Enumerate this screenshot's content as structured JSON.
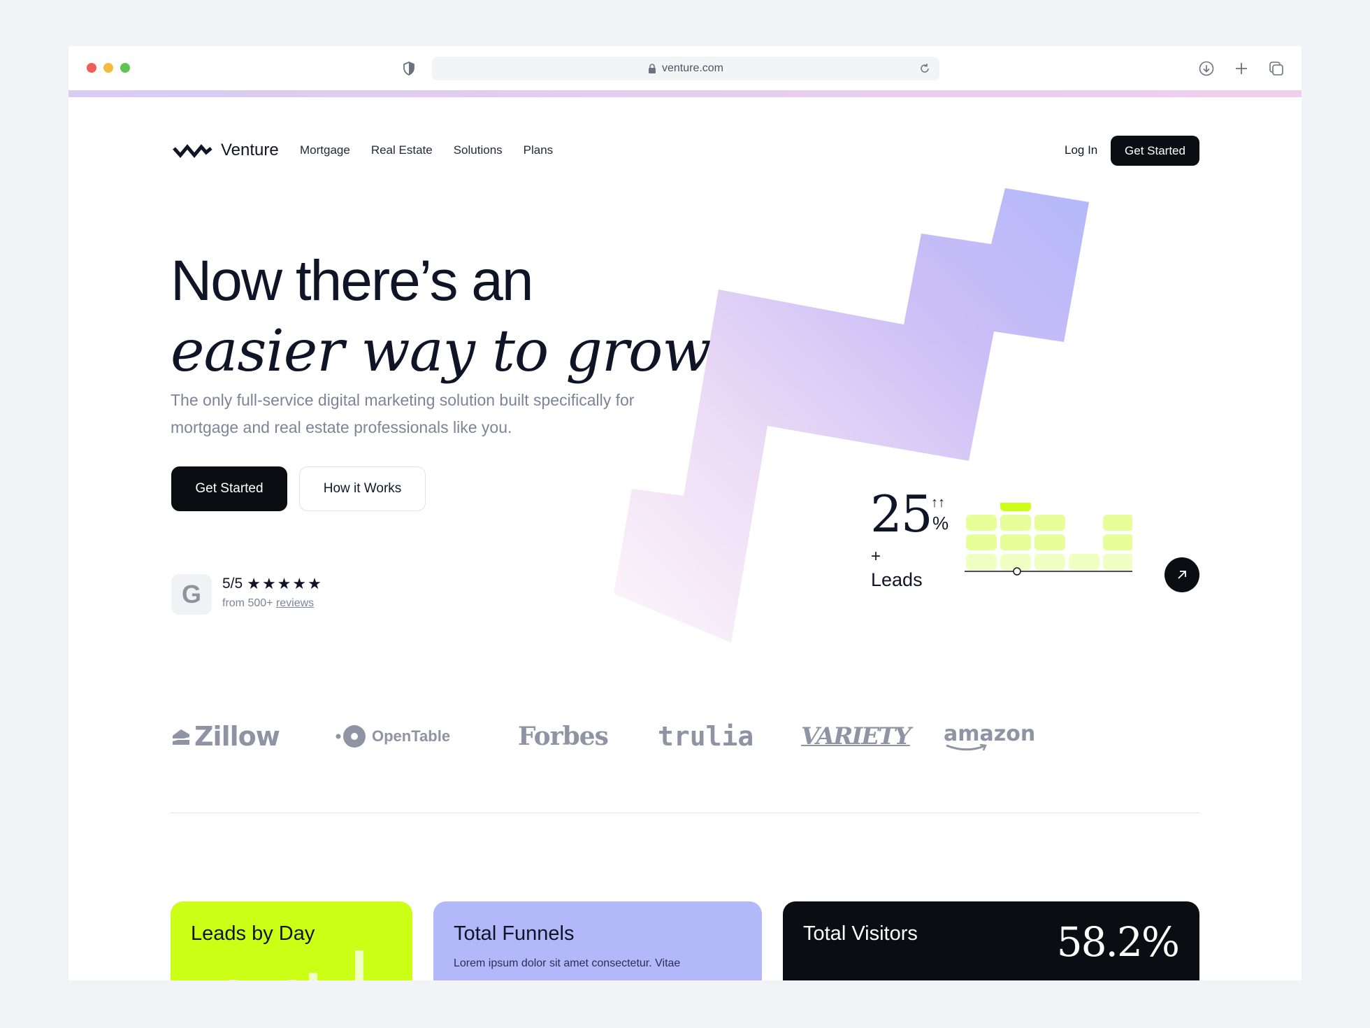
{
  "browser": {
    "url": "venture.com"
  },
  "nav": {
    "brand": "Venture",
    "links": [
      "Mortgage",
      "Real Estate",
      "Solutions",
      "Plans"
    ],
    "login": "Log In",
    "cta": "Get Started"
  },
  "hero": {
    "title_line1": "Now there’s an",
    "title_line2": "easier way to grow",
    "subtitle": "The only full-service digital marketing solution built specifically for mortgage and real estate professionals like you.",
    "primary_button": "Get Started",
    "secondary_button": "How it Works"
  },
  "rating": {
    "badge_letter": "G",
    "score": "5/5",
    "stars": 5,
    "star_glyph": "★",
    "from_text": "from 500+",
    "reviews_link": "reviews"
  },
  "leads_widget": {
    "value": "25",
    "arrows": "↑↑",
    "percent": "%",
    "plus": "+",
    "label": "Leads",
    "bar_levels": [
      3,
      4,
      3,
      1,
      3
    ],
    "highlight": {
      "column": 1,
      "level": 4
    },
    "colors": {
      "accent": "#ccff16",
      "light": "#e6ff99",
      "lighter": "#f0ffc2"
    }
  },
  "partner_logos": [
    "Zillow",
    "OpenTable",
    "Forbes",
    "trulia",
    "VARIETY",
    "amazon"
  ],
  "cards": [
    {
      "title": "Leads by Day",
      "color": "#ccff16"
    },
    {
      "title": "Total Funnels",
      "text": "Lorem ipsum dolor sit amet consectetur. Vitae",
      "color": "#b3b8fa"
    },
    {
      "title": "Total Visitors",
      "value": "58.2%",
      "color": "#0b0d12"
    }
  ],
  "icons": {
    "shield": "shield-icon",
    "lock": "lock-icon",
    "reload": "reload-icon",
    "download": "download-icon",
    "plus": "plus-icon",
    "tabs": "tabs-icon",
    "arrow": "arrow-up-right-icon"
  }
}
